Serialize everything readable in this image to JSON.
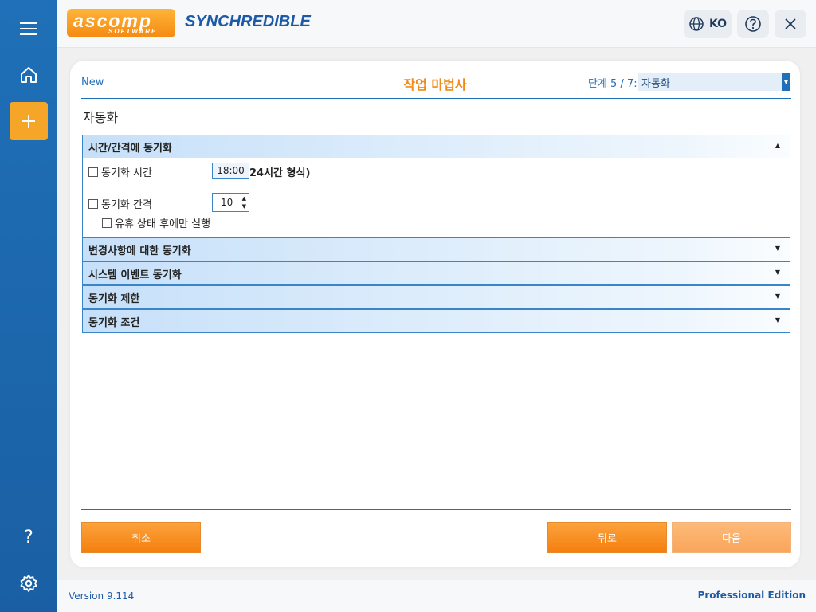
{
  "header": {
    "logo_main": "ascomp",
    "logo_sub": "SOFTWARE",
    "product": "SYNCHREDIBLE",
    "language": "KO"
  },
  "wizard": {
    "new_label": "New",
    "title": "작업 마법사",
    "step_label": "단계 5 / 7:",
    "step_value": "자동화",
    "section_title": "자동화"
  },
  "sections": {
    "time_interval": {
      "label": "시간/간격에 동기화",
      "sync_time_label": "동기화 시간",
      "sync_time_value": "18:00",
      "time_hint": "24시간 형식)",
      "interval_label": "동기화 간격",
      "interval_value": "10",
      "idle_only_label": "유휴 상태 후에만 실행",
      "sync_time_checked": false,
      "interval_checked": false,
      "idle_checked": false
    },
    "collapsed": [
      {
        "label": "변경사항에 대한 동기화"
      },
      {
        "label": "시스템 이벤트 동기화"
      },
      {
        "label": "동기화 제한"
      },
      {
        "label": "동기화 조건"
      }
    ]
  },
  "buttons": {
    "cancel": "취소",
    "back": "뒤로",
    "next": "다음"
  },
  "footer": {
    "version": "Version 9.114",
    "edition": "Professional Edition"
  },
  "colors": {
    "sidebar": "#1f70b8",
    "accent_orange": "#f58a11",
    "link_blue": "#1f70b8"
  },
  "icons": [
    "menu-icon",
    "home-icon",
    "plus-icon",
    "help-icon",
    "settings-icon",
    "globe-icon",
    "close-icon"
  ]
}
